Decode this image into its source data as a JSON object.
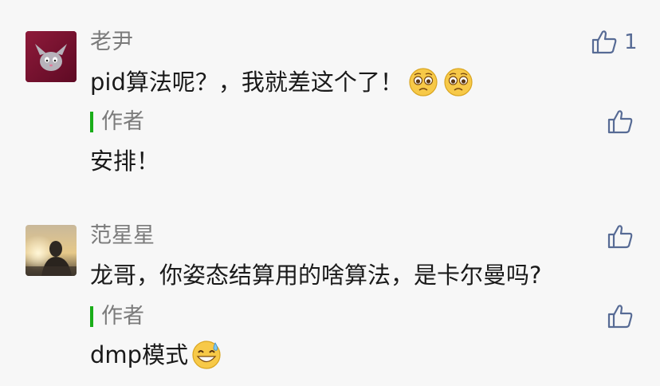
{
  "comments": [
    {
      "user": "老尹",
      "text": "pid算法呢？，我就差这个了！",
      "emoji": "pleading-face-icon",
      "likes": "1",
      "reply": {
        "label": "作者",
        "text": "安排！"
      }
    },
    {
      "user": "范星星",
      "text": "龙哥，你姿态结算用的啥算法，是卡尔曼吗?",
      "likes": "",
      "reply": {
        "label": "作者",
        "text": "dmp模式",
        "emoji": "grinning-sweat-icon"
      }
    }
  ],
  "colors": {
    "accent_green": "#1aad19",
    "like_blue": "#576b95",
    "name_gray": "#7b7b7b",
    "background": "#f7f7f7"
  }
}
